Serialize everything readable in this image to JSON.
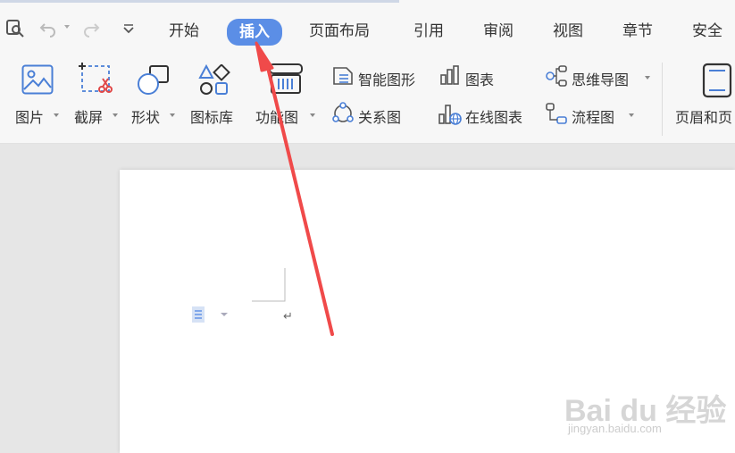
{
  "quick_access": {
    "print_preview_icon": "print-preview-icon",
    "undo_icon": "undo-icon",
    "redo_icon": "redo-icon",
    "customize_icon": "customize-icon"
  },
  "tabs": [
    {
      "label": "开始"
    },
    {
      "label": "插入",
      "active": true
    },
    {
      "label": "页面布局"
    },
    {
      "label": "引用"
    },
    {
      "label": "审阅"
    },
    {
      "label": "视图"
    },
    {
      "label": "章节"
    },
    {
      "label": "安全"
    }
  ],
  "ribbon": {
    "picture": "图片",
    "screenshot": "截屏",
    "shape": "形状",
    "icon_library": "图标库",
    "function_chart": "功能图",
    "smart_graphic": "智能图形",
    "relation_chart": "关系图",
    "chart": "图表",
    "online_chart": "在线图表",
    "mind_map": "思维导图",
    "flowchart": "流程图",
    "header_footer": "页眉和页"
  },
  "document": {
    "paragraph_mark": "↵"
  },
  "colors": {
    "accent": "#5b8ee6",
    "arrow": "#f04a4a",
    "icon_blue": "#4a7fd6"
  },
  "watermark": {
    "brand": "Bai du 经验",
    "url": "jingyan.baidu.com"
  }
}
